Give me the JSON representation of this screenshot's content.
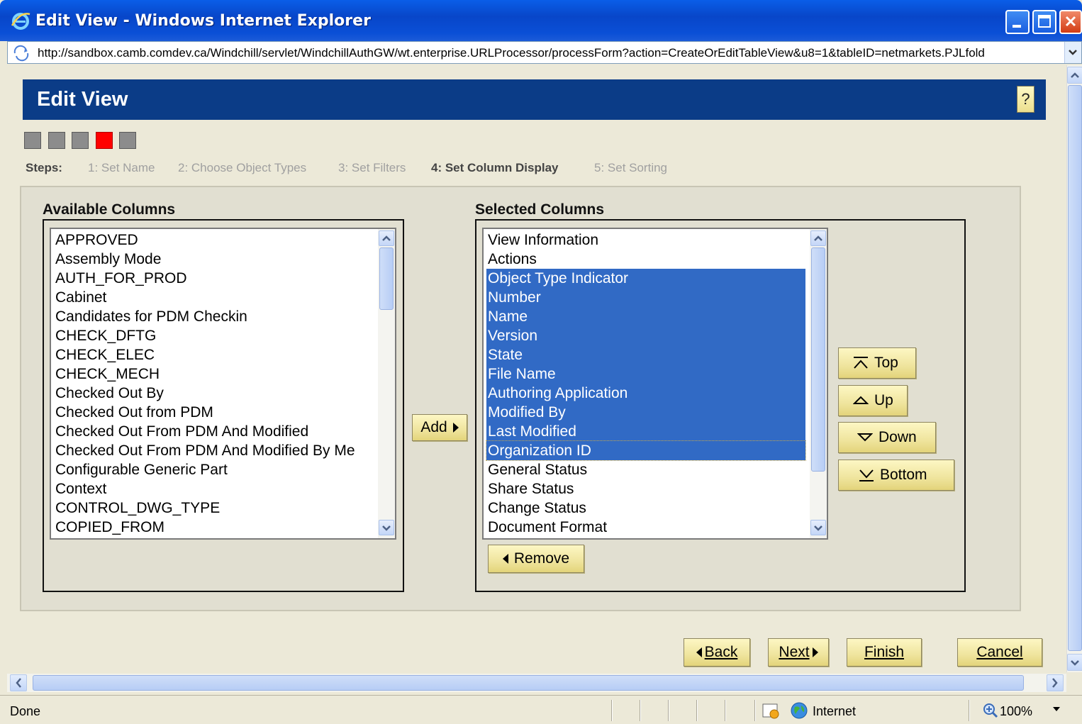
{
  "window": {
    "title": "Edit View - Windows Internet Explorer",
    "url": "http://sandbox.camb.comdev.ca/Windchill/servlet/WindchillAuthGW/wt.enterprise.URLProcessor/processForm?action=CreateOrEditTableView&u8=1&tableID=netmarkets.PJLfold"
  },
  "page": {
    "title": "Edit View",
    "help_label": "?"
  },
  "steps": {
    "label": "Steps:",
    "items": [
      {
        "label": "1: Set Name",
        "state": "inactive"
      },
      {
        "label": "2: Choose Object Types",
        "state": "inactive"
      },
      {
        "label": "3: Set Filters",
        "state": "inactive"
      },
      {
        "label": "4: Set Column Display",
        "state": "current"
      },
      {
        "label": "5: Set Sorting",
        "state": "inactive"
      }
    ],
    "current_index": 4
  },
  "available": {
    "title": "Available Columns",
    "items": [
      "APPROVED",
      "Assembly Mode",
      "AUTH_FOR_PROD",
      "Cabinet",
      "Candidates for PDM Checkin",
      "CHECK_DFTG",
      "CHECK_ELEC",
      "CHECK_MECH",
      "Checked Out By",
      "Checked Out from PDM",
      "Checked Out From PDM And Modified",
      "Checked Out From PDM And Modified By Me",
      "Configurable Generic Part",
      "Context",
      "CONTROL_DWG_TYPE",
      "COPIED_FROM"
    ]
  },
  "selected": {
    "title": "Selected Columns",
    "items": [
      {
        "label": "View Information",
        "selected": false
      },
      {
        "label": "Actions",
        "selected": false
      },
      {
        "label": "Object Type Indicator",
        "selected": true
      },
      {
        "label": "Number",
        "selected": true
      },
      {
        "label": "Name",
        "selected": true
      },
      {
        "label": "Version",
        "selected": true
      },
      {
        "label": "State",
        "selected": true
      },
      {
        "label": "File Name",
        "selected": true
      },
      {
        "label": "Authoring Application",
        "selected": true
      },
      {
        "label": "Modified By",
        "selected": true
      },
      {
        "label": "Last Modified",
        "selected": true
      },
      {
        "label": "Organization ID",
        "selected": true
      },
      {
        "label": "General Status",
        "selected": false
      },
      {
        "label": "Share Status",
        "selected": false
      },
      {
        "label": "Change Status",
        "selected": false
      },
      {
        "label": "Document Format",
        "selected": false
      }
    ]
  },
  "buttons": {
    "add": "Add",
    "remove": "Remove",
    "top": "Top",
    "up": "Up",
    "down": "Down",
    "bottom": "Bottom",
    "back": "Back",
    "next": "Next",
    "finish": "Finish",
    "cancel": "Cancel"
  },
  "status": {
    "text": "Done",
    "zone": "Internet",
    "zoom": "100%"
  },
  "colors": {
    "header_bg": "#0b3c87",
    "selection": "#316ac5",
    "active_step": "#ff0000",
    "button_bg": "#efe49d"
  }
}
